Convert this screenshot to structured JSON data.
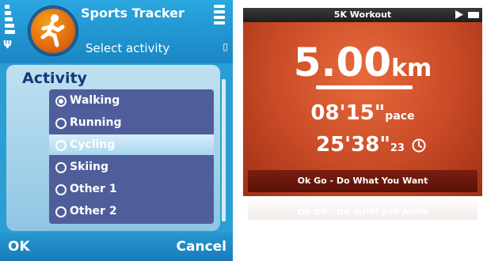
{
  "phone": {
    "app_title": "Sports Tracker",
    "subtitle": "Select activity",
    "panel_title": "Activity",
    "activities": [
      {
        "label": "Walking",
        "checked": true,
        "highlighted": false
      },
      {
        "label": "Running",
        "checked": false,
        "highlighted": false
      },
      {
        "label": "Cycling",
        "checked": false,
        "highlighted": true
      },
      {
        "label": "Skiing",
        "checked": false,
        "highlighted": false
      },
      {
        "label": "Other 1",
        "checked": false,
        "highlighted": false
      },
      {
        "label": "Other 2",
        "checked": false,
        "highlighted": false
      }
    ],
    "softkey_left": "OK",
    "softkey_right": "Cancel",
    "icons": {
      "logo": "runner-logo-icon",
      "signal": "signal-strength-icon",
      "battery": "battery-level-icon"
    },
    "colors": {
      "background": "#2b9ed3",
      "list": "#4f5e9a",
      "panel_title": "#103a78"
    }
  },
  "workout": {
    "title": "5K Workout",
    "distance_value": "5.00",
    "distance_unit": "km",
    "pace_value": "08'15\"",
    "pace_suffix": "pace",
    "time_value": "25'38\"",
    "time_sub": "23",
    "song": "Ok Go - Do What You Want",
    "icons": {
      "play": "play-icon",
      "battery": "battery-icon",
      "clock": "clock-icon"
    },
    "colors": {
      "background": "#c84a26",
      "topbar": "#2a2a2a",
      "song_bar": "#6a1a0c"
    }
  }
}
